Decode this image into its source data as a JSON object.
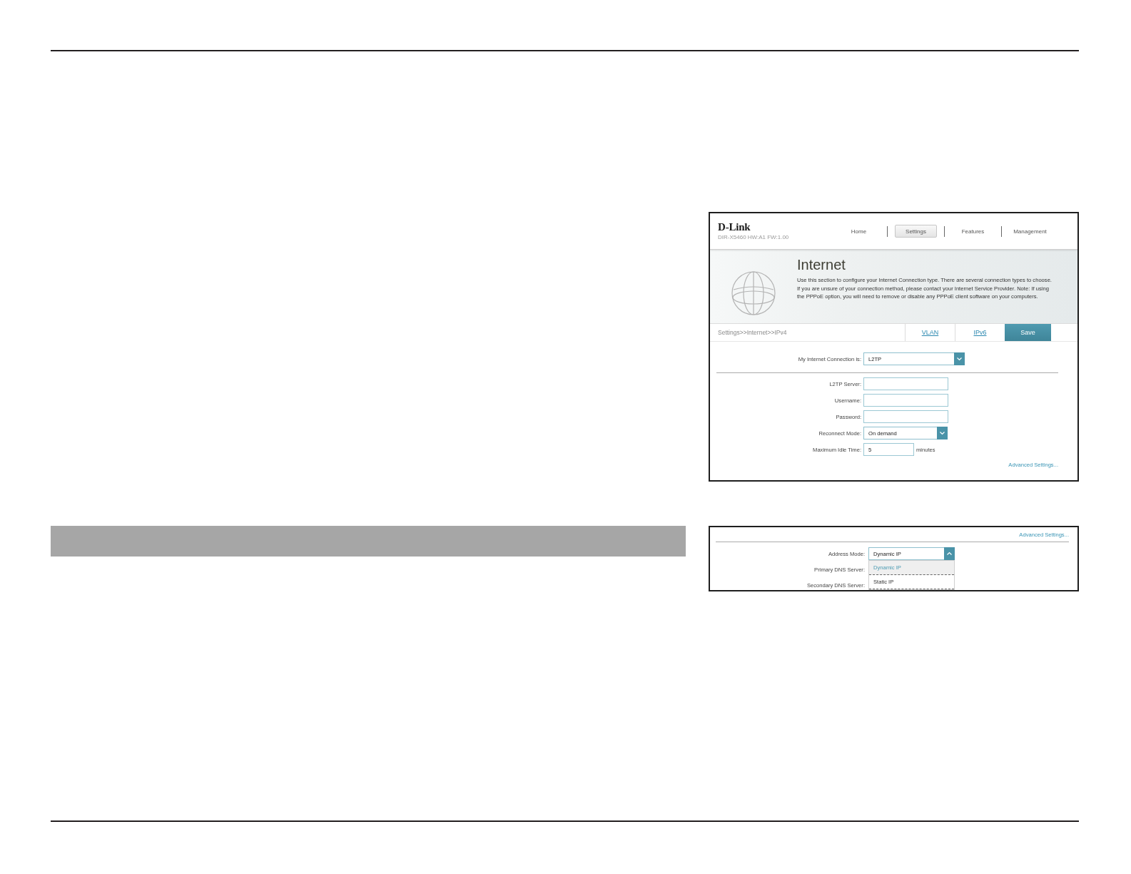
{
  "router_ui": {
    "logo": "D-Link",
    "model": "DIR-X5460 HW:A1 FW:1.00",
    "nav": [
      {
        "label": "Home",
        "selected": false
      },
      {
        "label": "Settings",
        "selected": true
      },
      {
        "label": "Features",
        "selected": false
      },
      {
        "label": "Management",
        "selected": false
      }
    ],
    "page_title": "Internet",
    "description_lines": [
      "Use this section to configure your Internet Connection type. There are several connection types to choose.",
      "If you are unsure of your connection method, please contact your Internet Service Provider. Note: If using",
      "the PPPoE option, you will need to remove or disable any PPPoE client software on your computers."
    ],
    "breadcrumb": "Settings>>Internet>>IPv4",
    "tabs": [
      {
        "label": "VLAN",
        "kind": "link"
      },
      {
        "label": "IPv6",
        "kind": "link"
      },
      {
        "label": "Save",
        "kind": "button"
      }
    ],
    "connection": {
      "label": "My Internet Connection is:",
      "value": "L2TP"
    },
    "fields": [
      {
        "label": "L2TP Server:",
        "kind": "text"
      },
      {
        "label": "Username:",
        "kind": "text"
      },
      {
        "label": "Password:",
        "kind": "text"
      },
      {
        "label": "Reconnect Mode:",
        "kind": "select",
        "value": "On demand"
      },
      {
        "label": "Maximum Idle Time:",
        "kind": "short",
        "value": "5",
        "unit": "minutes"
      }
    ],
    "advanced_link": "Advanced Settings..."
  },
  "advanced_ui": {
    "advanced_link": "Advanced Settings...",
    "address_mode": {
      "label": "Address Mode:",
      "value": "Dynamic IP",
      "expanded": true,
      "options": [
        {
          "label": "Dynamic IP",
          "selected": true
        },
        {
          "label": "Static IP",
          "selected": false
        }
      ]
    },
    "fields": [
      {
        "label": "Primary DNS Server:"
      },
      {
        "label": "Secondary DNS Server:"
      }
    ]
  }
}
